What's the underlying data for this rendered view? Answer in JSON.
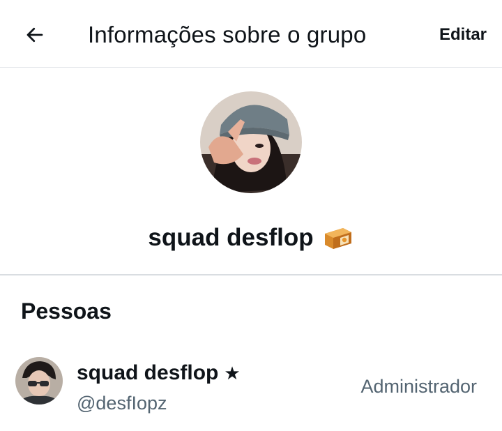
{
  "header": {
    "title": "Informações sobre o grupo",
    "back_icon": "arrow-left-icon",
    "edit_label": "Editar"
  },
  "group": {
    "name": "squad desflop",
    "emoji": "🥮",
    "avatar": "group-photo"
  },
  "people": {
    "title": "Pessoas",
    "members": [
      {
        "name": "squad desflop",
        "badge": "★",
        "handle": "@desfIopz",
        "role": "Administrador"
      }
    ]
  },
  "colors": {
    "text_primary": "#0f1419",
    "text_secondary": "#536471",
    "divider": "#e1e4e8"
  }
}
